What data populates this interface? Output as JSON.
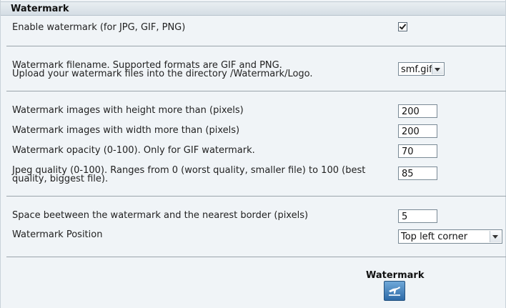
{
  "header": {
    "title": "Watermark"
  },
  "rows": {
    "enable": {
      "label": "Enable watermark (for JPG, GIF, PNG)",
      "checked": true
    },
    "filename": {
      "label_line1": "Watermark filename. Supported formats are GIF and PNG.",
      "label_line2": "Upload your watermark files into the directory /Watermark/Logo.",
      "selected": "smf.gif"
    },
    "height": {
      "label": "Watermark images with height more than (pixels)",
      "value": "200"
    },
    "width": {
      "label": "Watermark images with width more than (pixels)",
      "value": "200"
    },
    "opacity": {
      "label": "Watermark opacity (0-100). Only for GIF watermark.",
      "value": "70"
    },
    "jpeg": {
      "label_line1": "Jpeg quality (0-100). Ranges from 0 (worst quality, smaller file) to 100 (best",
      "label_line2": "quality, biggest file).",
      "value": "85"
    },
    "space": {
      "label": "Space beetween the watermark and the nearest border (pixels)",
      "value": "5"
    },
    "position": {
      "label": "Watermark Position",
      "selected": "Top left corner"
    }
  },
  "submit": {
    "title": "Watermark",
    "icon": "watermark-icon"
  }
}
